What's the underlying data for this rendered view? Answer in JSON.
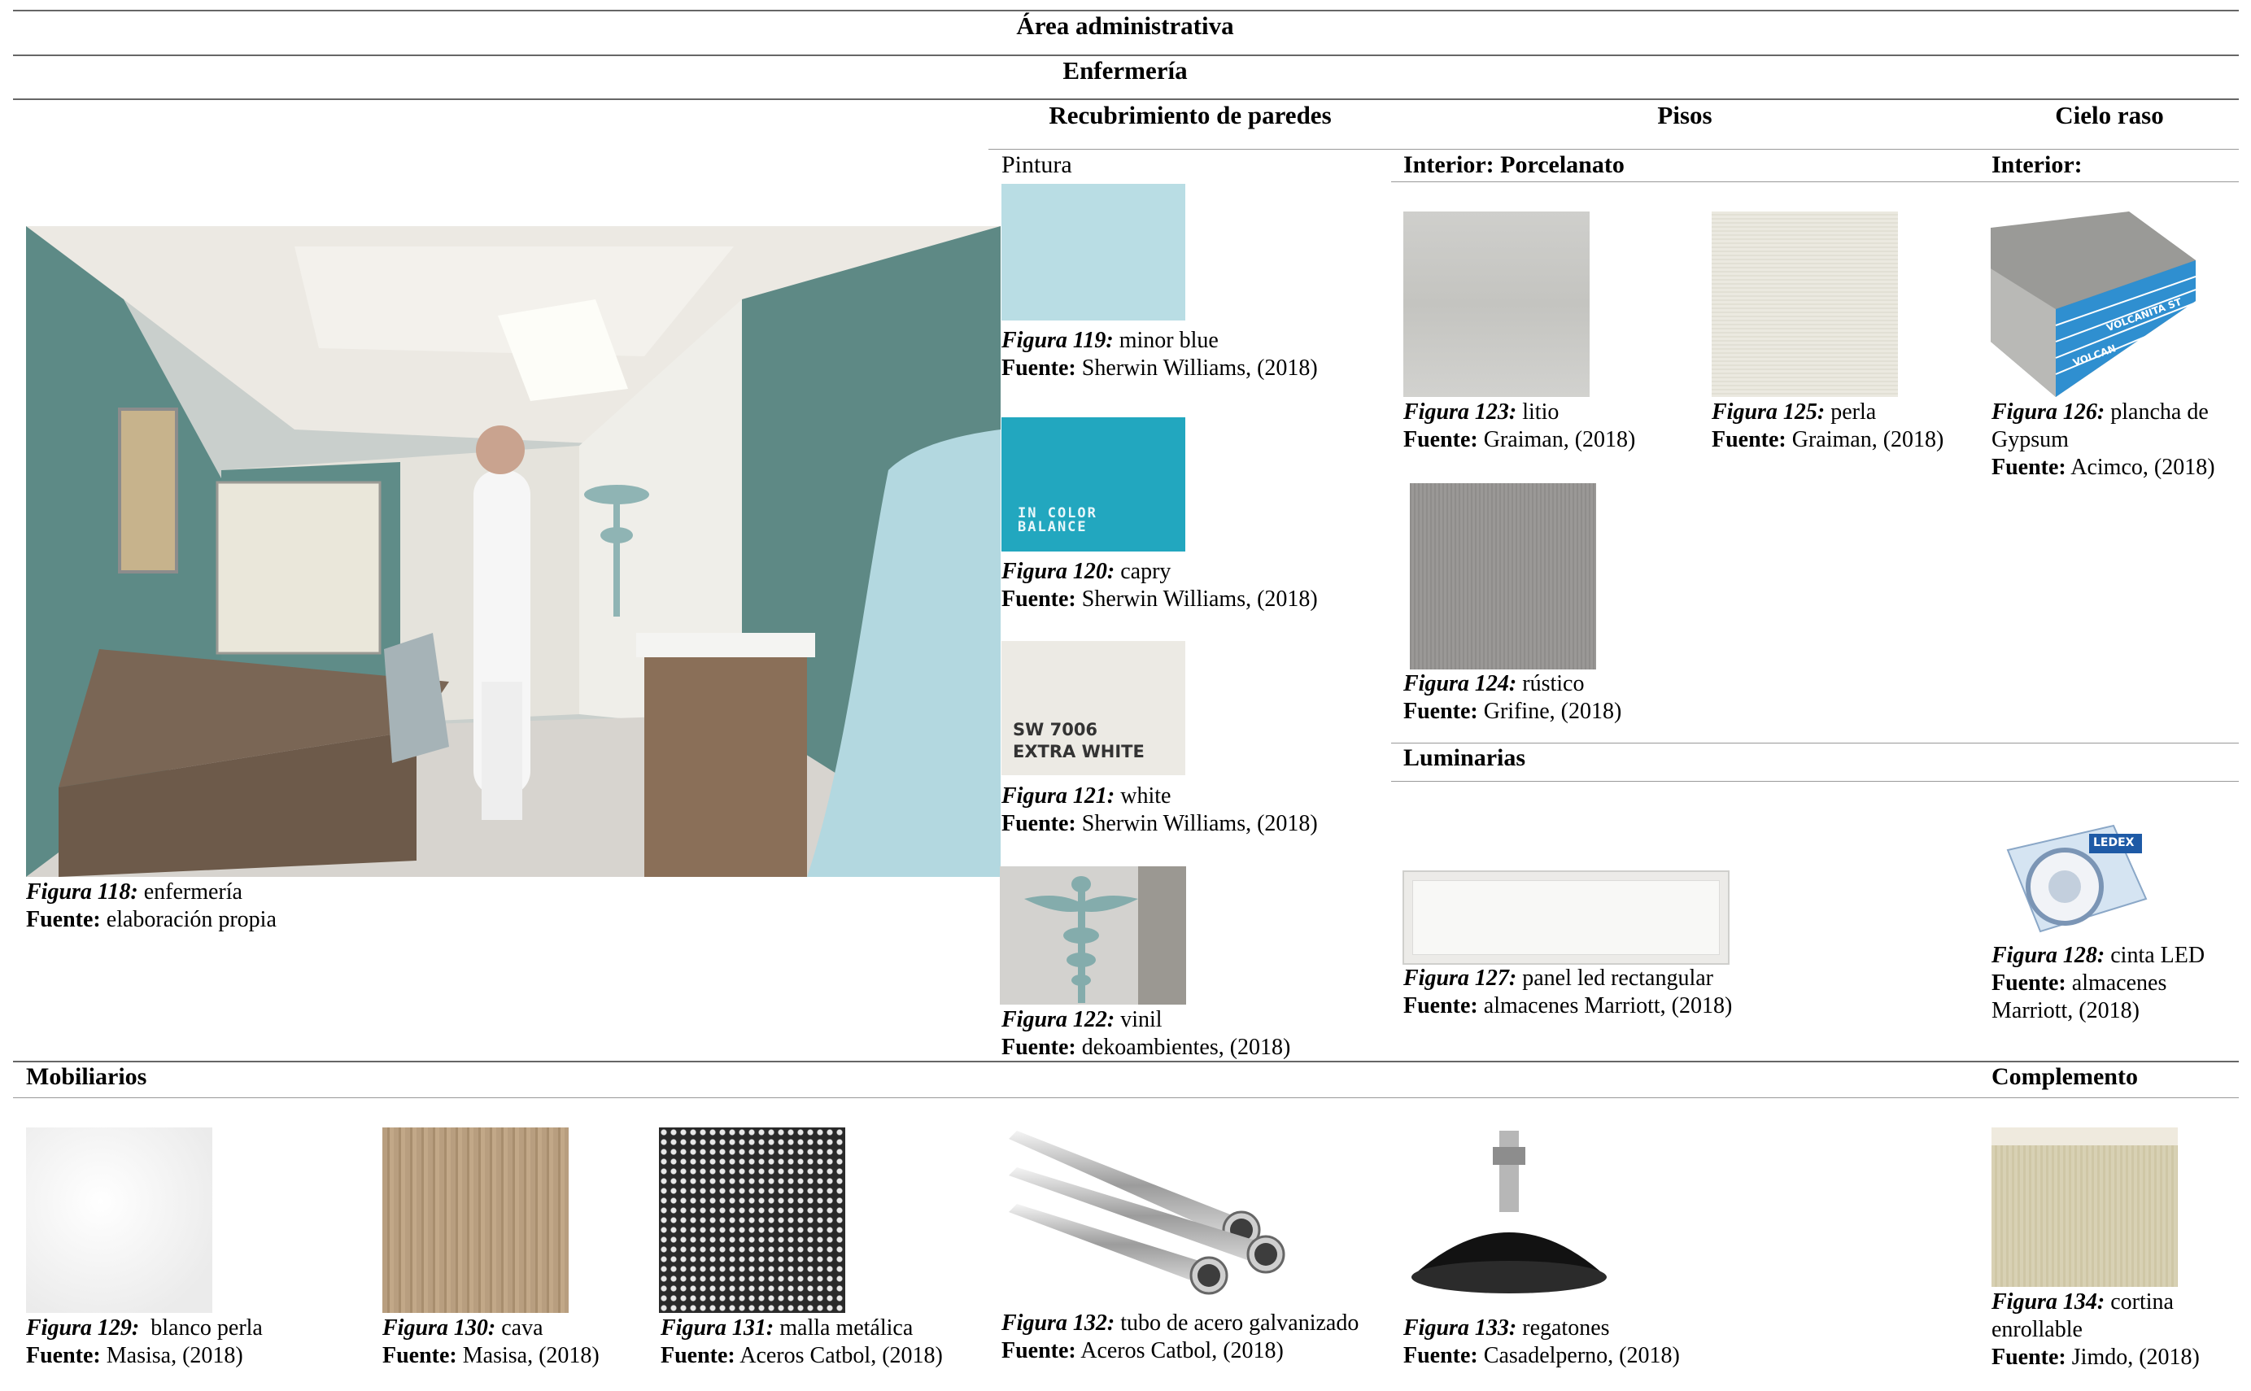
{
  "header": {
    "area_title": "Área administrativa",
    "section_title": "Enfermería",
    "col_walls": "Recubrimiento de paredes",
    "col_floors": "Pisos",
    "col_ceiling": "Cielo raso"
  },
  "walls": {
    "subtitle": "Pintura",
    "items": [
      {
        "fig": "Figura 119:",
        "name": "minor blue",
        "src_label": "Fuente:",
        "src": "Sherwin Williams, (2018)"
      },
      {
        "fig": "Figura 120:",
        "name": "capry",
        "src_label": "Fuente:",
        "src": "Sherwin Williams, (2018)",
        "swatch_text": "IN COLOR BALANCE"
      },
      {
        "fig": "Figura 121:",
        "name": "white",
        "src_label": "Fuente:",
        "src": "Sherwin Williams, (2018)",
        "swatch_text1": "SW 7006",
        "swatch_text2": "EXTRA WHITE"
      },
      {
        "fig": "Figura 122:",
        "name": "vinil",
        "src_label": "Fuente:",
        "src": "dekoambientes, (2018)"
      }
    ]
  },
  "render": {
    "fig": "Figura 118:",
    "name": "enfermería",
    "src_label": "Fuente:",
    "src": "elaboración propia"
  },
  "floors": {
    "subtitle": "Interior: Porcelanato",
    "items": [
      {
        "fig": "Figura 123:",
        "name": "litio",
        "src_label": "Fuente:",
        "src": "Graiman, (2018)"
      },
      {
        "fig": "Figura 125:",
        "name": "perla",
        "src_label": "Fuente:",
        "src": "Graiman, (2018)"
      },
      {
        "fig": "Figura 124:",
        "name": "rústico",
        "src_label": "Fuente:",
        "src": "Grifine, (2018)"
      }
    ]
  },
  "ceiling": {
    "subtitle": "Interior:",
    "item": {
      "fig": "Figura 126:",
      "name": "plancha de",
      "name2": "Gypsum",
      "src_label": "Fuente:",
      "src": "Acimco, (2018)",
      "board_text": "VOLCANITA ST",
      "brand_text": "VOLCAN"
    }
  },
  "lighting": {
    "subtitle": "Luminarias",
    "items": [
      {
        "fig": "Figura 127:",
        "name": "panel led rectangular",
        "src_label": "Fuente:",
        "src": "almacenes Marriott, (2018)"
      },
      {
        "fig": "Figura 128:",
        "name": "cinta LED",
        "src_label": "Fuente:",
        "src": "almacenes",
        "src2": "Marriott, (2018)",
        "brand_text": "LEDEX"
      }
    ]
  },
  "furniture": {
    "subtitle": "Mobiliarios",
    "items": [
      {
        "fig": "Figura 129:",
        "name": " blanco perla",
        "src_label": "Fuente:",
        "src": "Masisa, (2018)"
      },
      {
        "fig": "Figura 130:",
        "name": "cava",
        "src_label": "Fuente:",
        "src": "Masisa, (2018)"
      },
      {
        "fig": "Figura 131:",
        "name": "malla metálica",
        "src_label": "Fuente:",
        "src": "Aceros Catbol, (2018)"
      },
      {
        "fig": "Figura 132:",
        "name": "tubo de acero galvanizado",
        "src_label": "Fuente:",
        "src": "Aceros Catbol, (2018)"
      },
      {
        "fig": "Figura 133:",
        "name": "regatones",
        "src_label": "Fuente:",
        "src": "Casadelperno, (2018)"
      }
    ]
  },
  "complement": {
    "subtitle": "Complemento",
    "item": {
      "fig": "Figura 134:",
      "name": "cortina",
      "name2": "enrollable",
      "src_label": "Fuente:",
      "src": "Jimdo, (2018)"
    }
  },
  "colors": {
    "minor_blue": "#b9dde4",
    "capry": "#22a7bf",
    "white": "#eceae4",
    "wall_teal": "#5d8a86"
  }
}
